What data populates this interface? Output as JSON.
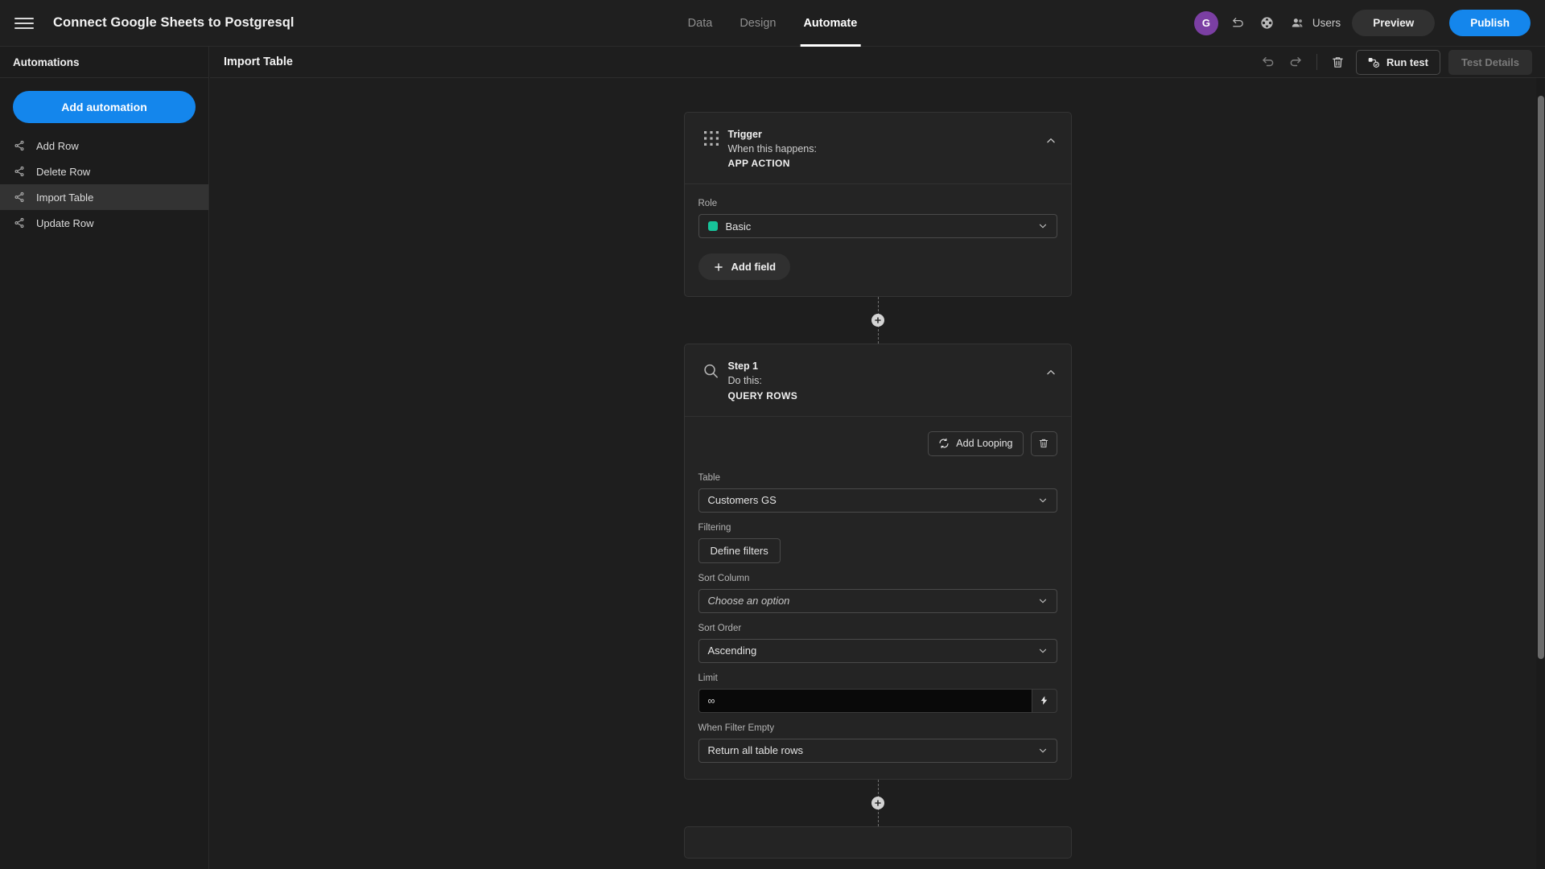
{
  "topbar": {
    "menu_icon": "hamburger-icon",
    "app_title": "Connect Google Sheets to Postgresql",
    "tabs": [
      {
        "label": "Data",
        "active": false
      },
      {
        "label": "Design",
        "active": false
      },
      {
        "label": "Automate",
        "active": true
      }
    ],
    "avatar_initial": "G",
    "revert_icon": "undo-icon",
    "globe_icon": "globe-icon",
    "users_icon": "users-icon",
    "users_label": "Users",
    "preview_label": "Preview",
    "publish_label": "Publish",
    "publish_color": "#1486ec"
  },
  "sidebar": {
    "heading": "Automations",
    "add_automation_label": "Add automation",
    "items": [
      {
        "label": "Add Row",
        "icon": "share-nodes-icon",
        "active": false
      },
      {
        "label": "Delete Row",
        "icon": "share-nodes-icon",
        "active": false
      },
      {
        "label": "Import Table",
        "icon": "share-nodes-icon",
        "active": true
      },
      {
        "label": "Update Row",
        "icon": "share-nodes-icon",
        "active": false
      }
    ]
  },
  "content_header": {
    "page_title": "Import Table",
    "undo_icon": "undo-icon",
    "redo_icon": "redo-icon",
    "delete_icon": "trash-icon",
    "run_test_label": "Run test",
    "run_test_icon": "run-test-icon",
    "test_details_label": "Test Details",
    "test_details_disabled": true
  },
  "flow": {
    "trigger": {
      "icon": "grid-dots-icon",
      "title": "Trigger",
      "subtitle": "When this happens:",
      "type": "APP ACTION",
      "collapse_icon": "chevron-up-icon",
      "fields": [
        {
          "label": "Role",
          "control": "select",
          "value": "Basic",
          "swatch_color": "#17c39a"
        }
      ],
      "add_field_label": "Add field",
      "add_field_icon": "plus-icon"
    },
    "step1": {
      "icon": "magnifier-icon",
      "title": "Step 1",
      "subtitle": "Do this:",
      "type": "QUERY ROWS",
      "collapse_icon": "chevron-up-icon",
      "add_looping_label": "Add Looping",
      "add_looping_icon": "loop-icon",
      "delete_icon": "trash-icon",
      "fields": [
        {
          "label": "Table",
          "control": "select",
          "value": "Customers GS"
        },
        {
          "label": "Filtering",
          "control": "button",
          "value": "Define filters"
        },
        {
          "label": "Sort Column",
          "control": "select",
          "value": "Choose an option",
          "placeholder": true
        },
        {
          "label": "Sort Order",
          "control": "select",
          "value": "Ascending"
        },
        {
          "label": "Limit",
          "control": "input",
          "value": "∞",
          "action_icon": "lightning-icon"
        },
        {
          "label": "When Filter Empty",
          "control": "select",
          "value": "Return all table rows"
        }
      ]
    },
    "connector_icon": "plus-circle-icon"
  }
}
